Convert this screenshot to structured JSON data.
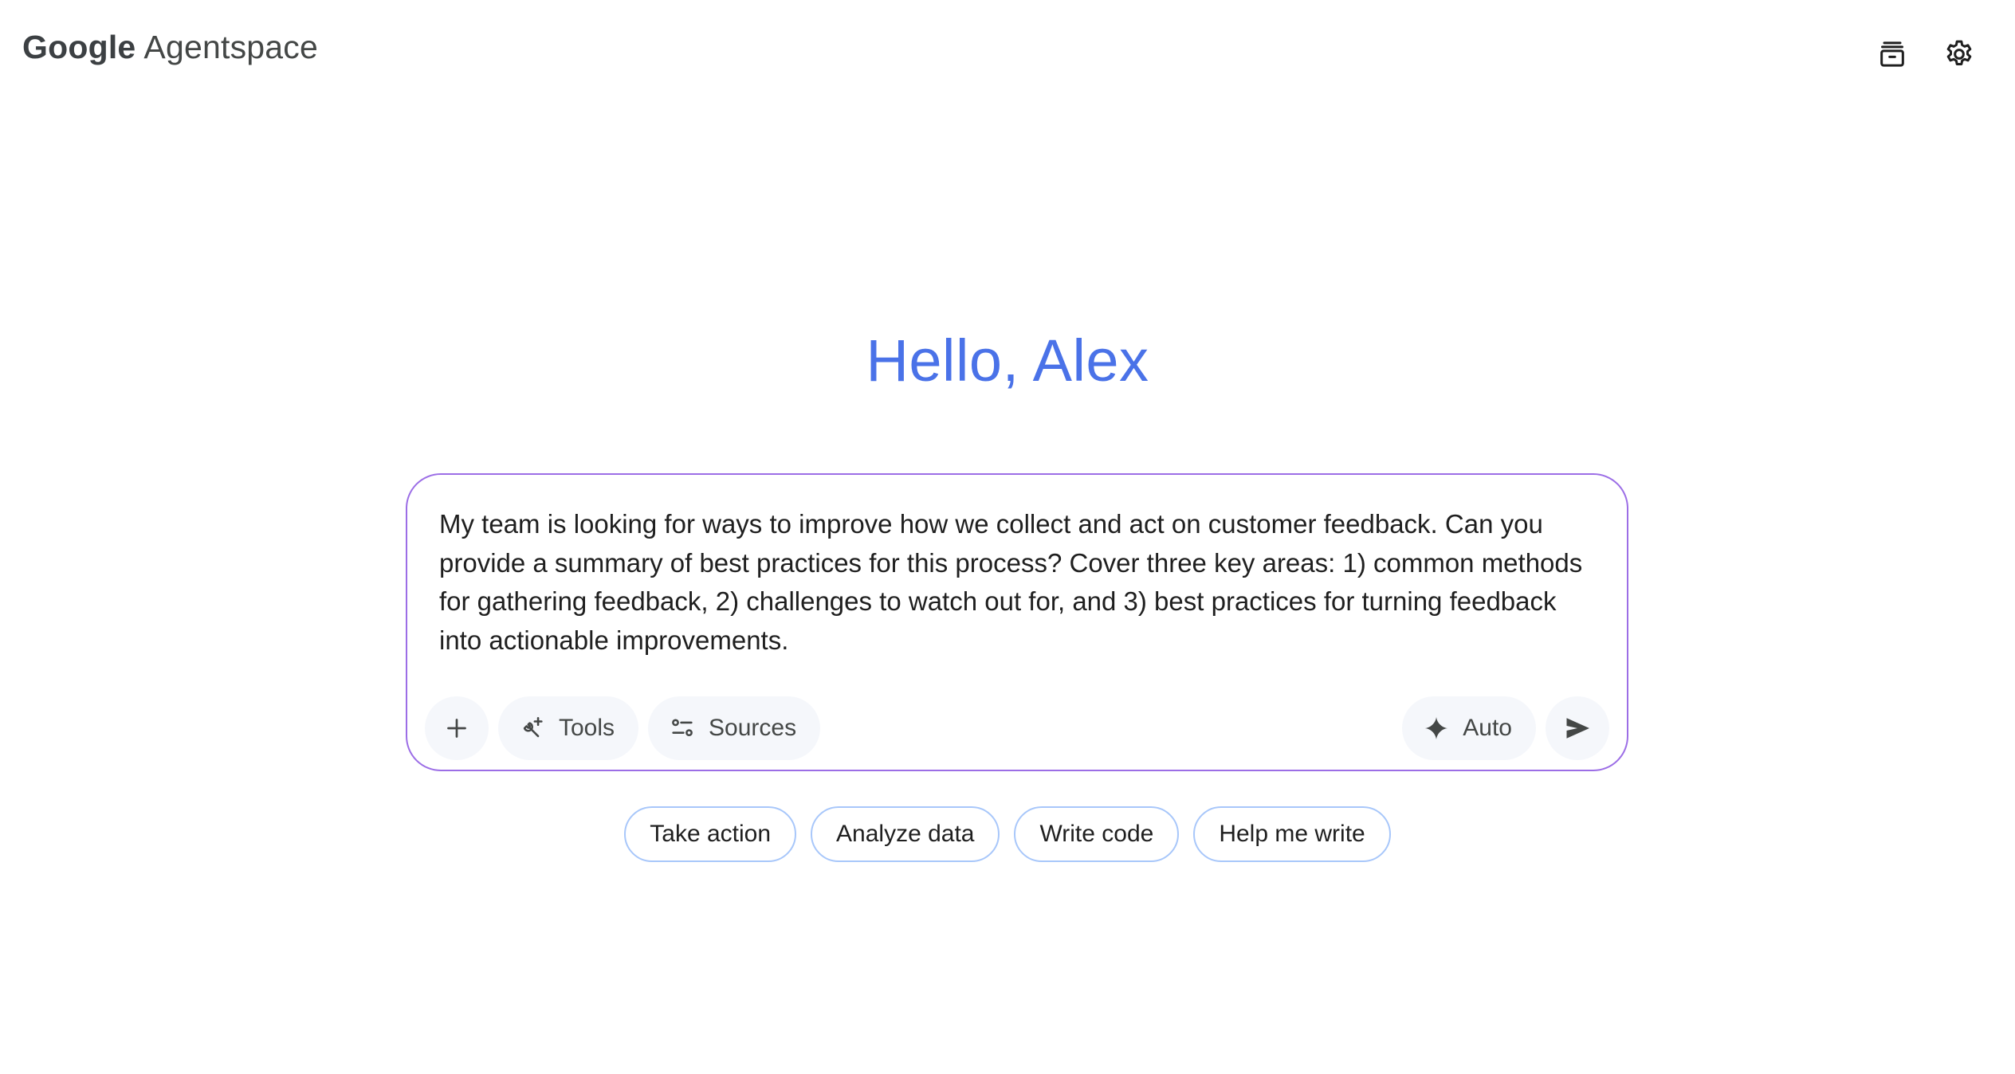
{
  "brand": {
    "google": "Google",
    "product": "Agentspace"
  },
  "header": {
    "icons": [
      "archive-icon",
      "settings-gear-icon"
    ]
  },
  "greeting": "Hello, Alex",
  "prompt": {
    "text": "My team is looking for ways to improve how we collect and act on customer feedback. Can you provide a summary of best practices for this process? Cover three key areas: 1) common methods for gathering feedback, 2) challenges to watch out for, and 3) best practices for turning feedback into actionable improvements.",
    "toolbar": {
      "add_icon": "plus-icon",
      "tools_label": "Tools",
      "sources_label": "Sources",
      "model_label": "Auto",
      "send_icon": "send-icon"
    }
  },
  "suggestions": [
    "Take action",
    "Analyze data",
    "Write code",
    "Help me write"
  ],
  "colors": {
    "greeting": "#4a72e8",
    "card_border": "#9c6ee6",
    "chip_border": "#a8c7fa",
    "pill_bg": "#f5f7fb"
  }
}
